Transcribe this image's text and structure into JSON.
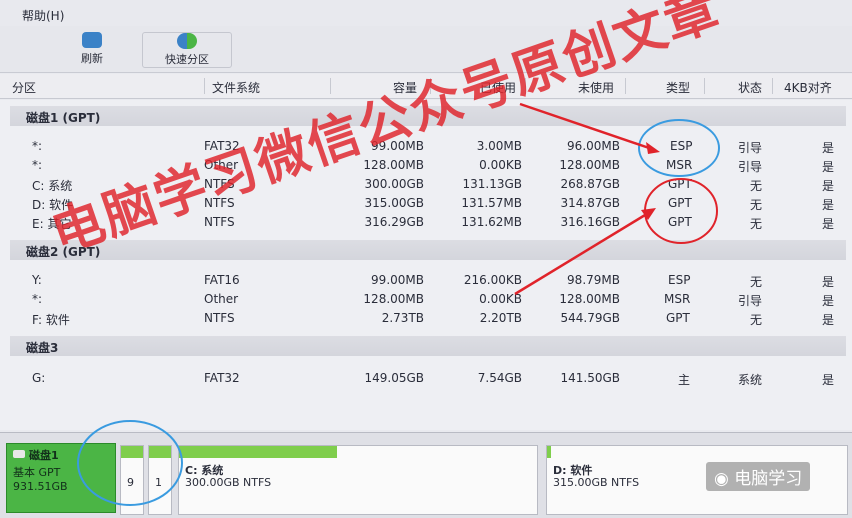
{
  "menu": {
    "help": "帮助(H)"
  },
  "toolbar": {
    "refresh": "刷新",
    "quick_partition": "快速分区"
  },
  "columns": {
    "partition": "分区",
    "filesystem": "文件系统",
    "capacity": "容量",
    "used": "已使用",
    "unused": "未使用",
    "type": "类型",
    "status": "状态",
    "align4k": "4KB对齐"
  },
  "disks": [
    {
      "title": "磁盘1 (GPT)",
      "rows": [
        {
          "name": "*:",
          "fs": "FAT32",
          "cap": "99.00MB",
          "used": "3.00MB",
          "free": "96.00MB",
          "type": "ESP",
          "status": "引导",
          "align": "是"
        },
        {
          "name": "*:",
          "fs": "Other",
          "cap": "128.00MB",
          "used": "0.00KB",
          "free": "128.00MB",
          "type": "MSR",
          "status": "引导",
          "align": "是"
        },
        {
          "name": "C: 系统",
          "fs": "NTFS",
          "cap": "300.00GB",
          "used": "131.13GB",
          "free": "268.87GB",
          "type": "GPT",
          "status": "无",
          "align": "是"
        },
        {
          "name": "D: 软件",
          "fs": "NTFS",
          "cap": "315.00GB",
          "used": "131.57MB",
          "free": "314.87GB",
          "type": "GPT",
          "status": "无",
          "align": "是"
        },
        {
          "name": "E: 其它",
          "fs": "NTFS",
          "cap": "316.29GB",
          "used": "131.62MB",
          "free": "316.16GB",
          "type": "GPT",
          "status": "无",
          "align": "是"
        }
      ]
    },
    {
      "title": "磁盘2 (GPT)",
      "rows": [
        {
          "name": "Y:",
          "fs": "FAT16",
          "cap": "99.00MB",
          "used": "216.00KB",
          "free": "98.79MB",
          "type": "ESP",
          "status": "无",
          "align": "是"
        },
        {
          "name": "*:",
          "fs": "Other",
          "cap": "128.00MB",
          "used": "0.00KB",
          "free": "128.00MB",
          "type": "MSR",
          "status": "引导",
          "align": "是"
        },
        {
          "name": "F: 软件",
          "fs": "NTFS",
          "cap": "2.73TB",
          "used": "2.20TB",
          "free": "544.79GB",
          "type": "GPT",
          "status": "无",
          "align": "是"
        }
      ]
    },
    {
      "title": "磁盘3",
      "rows": [
        {
          "name": "G:",
          "fs": "FAT32",
          "cap": "149.05GB",
          "used": "7.54GB",
          "free": "141.50GB",
          "type": "主",
          "status": "系统",
          "align": "是"
        }
      ]
    }
  ],
  "diskmap": {
    "disk": {
      "name": "磁盘1",
      "type": "基本 GPT",
      "size": "931.51GB"
    },
    "small": [
      "9",
      "1"
    ],
    "parts": [
      {
        "label": "C: 系统",
        "detail": "300.00GB NTFS"
      },
      {
        "label": "D: 软件",
        "detail": "315.00GB NTFS"
      }
    ]
  },
  "watermark": "电脑学习微信公众号原创文章",
  "wechat": "电脑学习",
  "colors": {
    "accent_red": "#e0232a",
    "partition_green": "#4bb545",
    "annotation_blue": "#3a9be0"
  }
}
